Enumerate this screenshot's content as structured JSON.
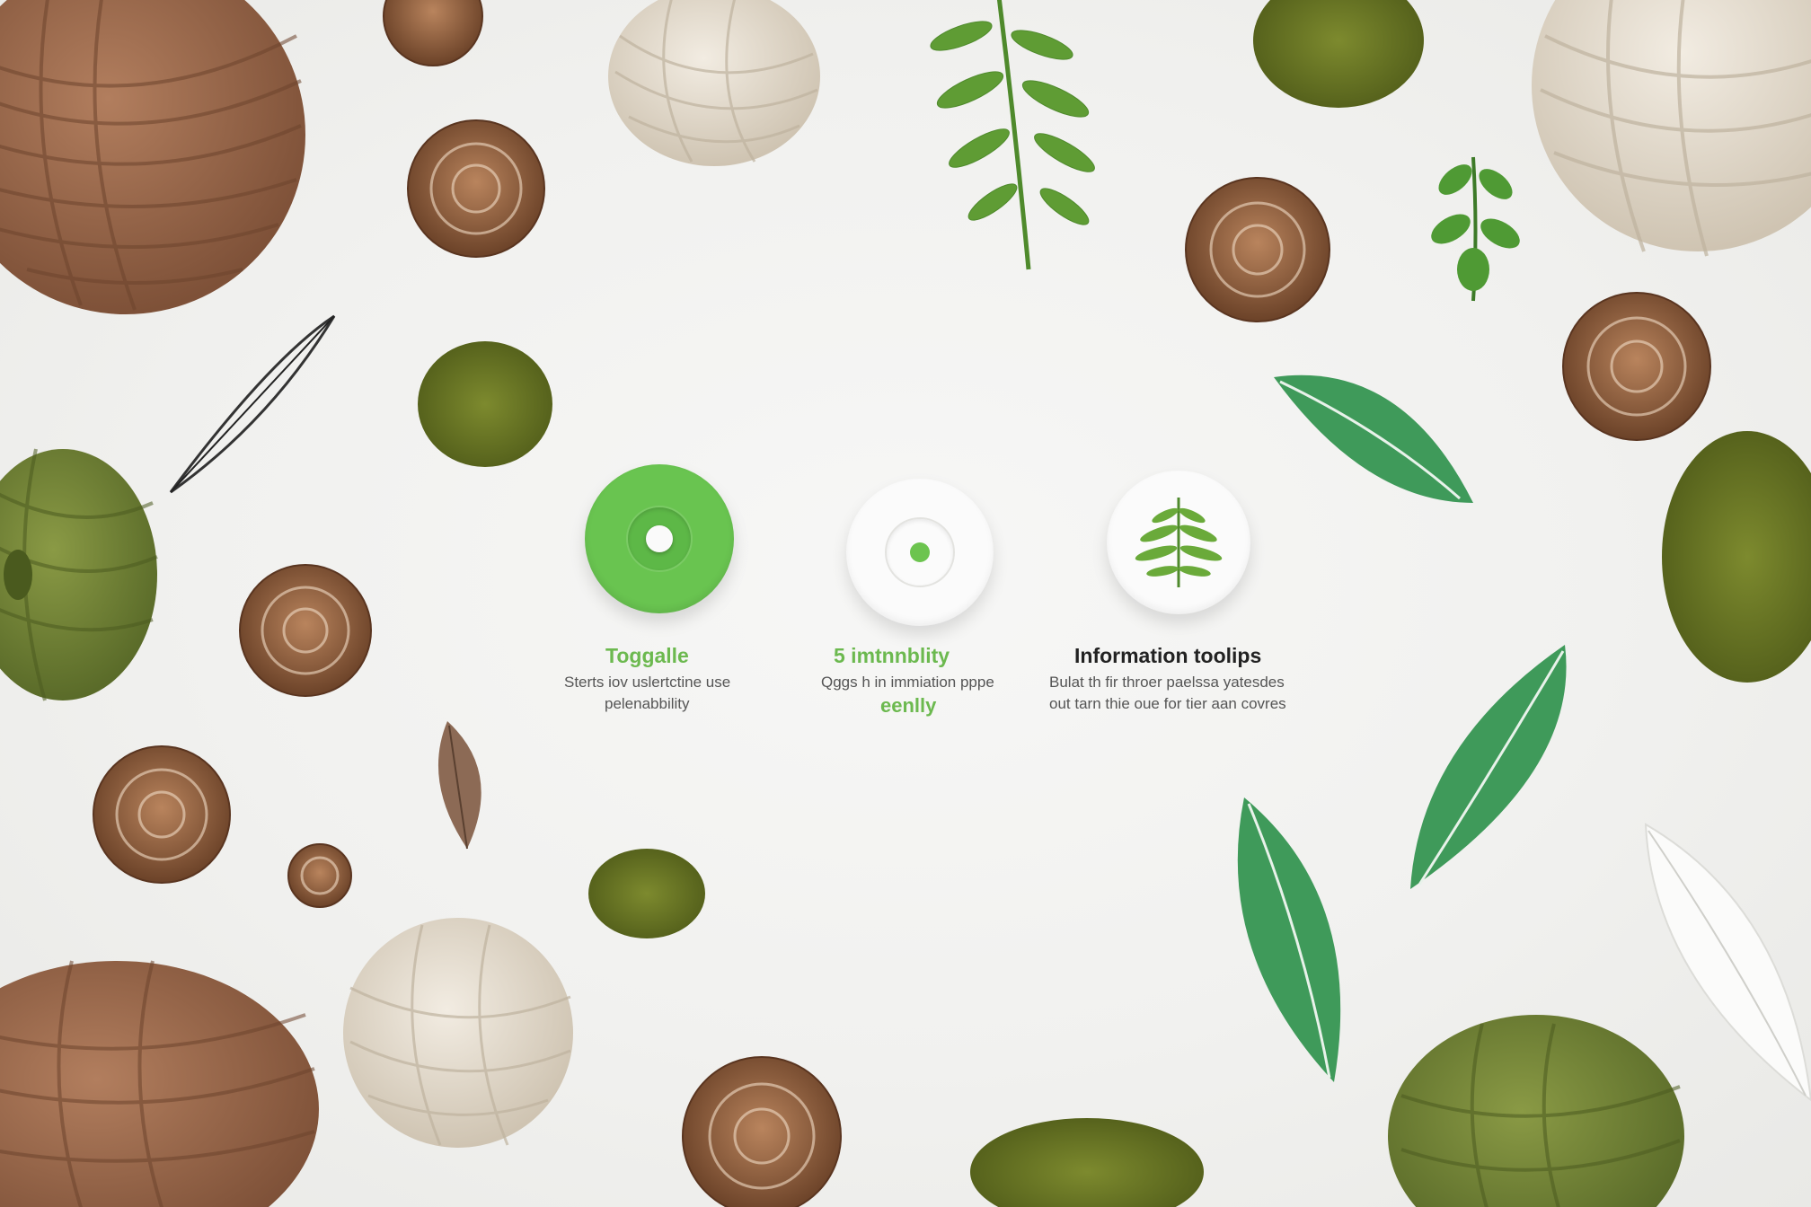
{
  "features": [
    {
      "id": "toggle",
      "title": "Toggalle",
      "desc_line1": "Sterts iov uslertctine use",
      "desc_line2": "pelenabbility"
    },
    {
      "id": "visibility",
      "title": "5 imtnnblity",
      "desc_line1": "Qggs h in immiation pppe",
      "desc_line2": "eenlly"
    },
    {
      "id": "info",
      "title": "Information toolips",
      "desc_line1": "Bulat th fir throer paelssa yatesdes",
      "desc_line2": "out tarn thie oue for tier aan covres"
    }
  ],
  "colors": {
    "accent_green": "#69c450",
    "background": "#f1f1ef"
  },
  "icons": [
    "toggle-switch-icon",
    "visibility-dot-icon",
    "fern-info-icon"
  ]
}
